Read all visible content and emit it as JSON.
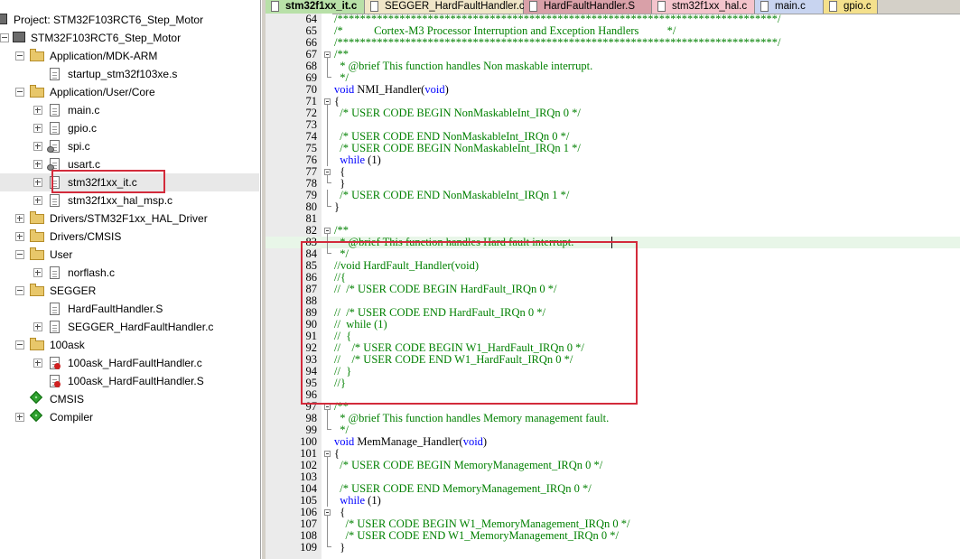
{
  "project": {
    "title": "Project: STM32F103RCT6_Step_Motor",
    "target": "STM32F103RCT6_Step_Motor",
    "groups": [
      {
        "label": "Application/MDK-ARM",
        "files": [
          "startup_stm32f103xe.s"
        ]
      },
      {
        "label": "Application/User/Core",
        "files": [
          "main.c",
          "gpio.c",
          "spi.c",
          "usart.c",
          "stm32f1xx_it.c",
          "stm32f1xx_hal_msp.c"
        ]
      },
      {
        "label": "Drivers/STM32F1xx_HAL_Driver"
      },
      {
        "label": "Drivers/CMSIS"
      },
      {
        "label": "User",
        "files": [
          "norflash.c"
        ]
      },
      {
        "label": "SEGGER",
        "files": [
          "HardFaultHandler.S",
          "SEGGER_HardFaultHandler.c"
        ]
      },
      {
        "label": "100ask",
        "files": [
          "100ask_HardFaultHandler.c",
          "100ask_HardFaultHandler.S"
        ]
      }
    ],
    "components": [
      "CMSIS",
      "Compiler"
    ],
    "selected_file": "stm32f1xx_it.c"
  },
  "tabs": [
    {
      "label": "stm32f1xx_it.c",
      "color": "#b8e0a8",
      "active": true
    },
    {
      "label": "SEGGER_HardFaultHandler.c",
      "color": "#f0e6c8"
    },
    {
      "label": "HardFaultHandler.S",
      "color": "#d9a0a8"
    },
    {
      "label": "stm32f1xx_hal.c",
      "color": "#f4c4cc"
    },
    {
      "label": "main.c",
      "color": "#c8d4f0"
    },
    {
      "label": "gpio.c",
      "color": "#f4e08c"
    }
  ],
  "editor": {
    "current_line": "83",
    "lines": [
      {
        "n": "64",
        "fold": "none",
        "parts": [
          [
            "c",
            "/******************************************************************************/"
          ]
        ]
      },
      {
        "n": "65",
        "fold": "none",
        "parts": [
          [
            "c",
            "/*           Cortex-M3 Processor Interruption and Exception Handlers          */"
          ]
        ]
      },
      {
        "n": "66",
        "fold": "none",
        "parts": [
          [
            "c",
            "/******************************************************************************/"
          ]
        ]
      },
      {
        "n": "67",
        "fold": "start",
        "parts": [
          [
            "c",
            "/**"
          ]
        ]
      },
      {
        "n": "68",
        "fold": "mid",
        "parts": [
          [
            "c",
            "  * @brief This function handles Non maskable interrupt."
          ]
        ]
      },
      {
        "n": "69",
        "fold": "end",
        "parts": [
          [
            "c",
            "  */"
          ]
        ]
      },
      {
        "n": "70",
        "fold": "none",
        "parts": [
          [
            "k",
            "void"
          ],
          [
            "t",
            " NMI_Handler("
          ],
          [
            "k",
            "void"
          ],
          [
            "t",
            ")"
          ]
        ]
      },
      {
        "n": "71",
        "fold": "start",
        "parts": [
          [
            "t",
            "{"
          ]
        ]
      },
      {
        "n": "72",
        "fold": "mid",
        "parts": [
          [
            "c",
            "  /* USER CODE BEGIN NonMaskableInt_IRQn 0 */"
          ]
        ]
      },
      {
        "n": "73",
        "fold": "mid",
        "parts": []
      },
      {
        "n": "74",
        "fold": "mid",
        "parts": [
          [
            "c",
            "  /* USER CODE END NonMaskableInt_IRQn 0 */"
          ]
        ]
      },
      {
        "n": "75",
        "fold": "mid",
        "parts": [
          [
            "c",
            "  /* USER CODE BEGIN NonMaskableInt_IRQn 1 */"
          ]
        ]
      },
      {
        "n": "76",
        "fold": "mid",
        "parts": [
          [
            "t",
            "  "
          ],
          [
            "k",
            "while"
          ],
          [
            "t",
            " (1)"
          ]
        ]
      },
      {
        "n": "77",
        "fold": "start",
        "parts": [
          [
            "t",
            "  {"
          ]
        ]
      },
      {
        "n": "78",
        "fold": "end",
        "parts": [
          [
            "t",
            "  }"
          ]
        ]
      },
      {
        "n": "79",
        "fold": "mid",
        "parts": [
          [
            "c",
            "  /* USER CODE END NonMaskableInt_IRQn 1 */"
          ]
        ]
      },
      {
        "n": "80",
        "fold": "end",
        "parts": [
          [
            "t",
            "}"
          ]
        ]
      },
      {
        "n": "81",
        "fold": "none",
        "parts": []
      },
      {
        "n": "82",
        "fold": "start",
        "parts": [
          [
            "c",
            "/**"
          ]
        ]
      },
      {
        "n": "83",
        "fold": "mid",
        "parts": [
          [
            "c",
            "  * @brief This function handles Hard fault interrupt."
          ]
        ]
      },
      {
        "n": "84",
        "fold": "end",
        "parts": [
          [
            "c",
            "  */"
          ]
        ]
      },
      {
        "n": "85",
        "fold": "none",
        "parts": [
          [
            "c",
            "//void HardFault_Handler(void)"
          ]
        ]
      },
      {
        "n": "86",
        "fold": "none",
        "parts": [
          [
            "c",
            "//{"
          ]
        ]
      },
      {
        "n": "87",
        "fold": "none",
        "parts": [
          [
            "c",
            "//  /* USER CODE BEGIN HardFault_IRQn 0 */"
          ]
        ]
      },
      {
        "n": "88",
        "fold": "none",
        "parts": []
      },
      {
        "n": "89",
        "fold": "none",
        "parts": [
          [
            "c",
            "//  /* USER CODE END HardFault_IRQn 0 */"
          ]
        ]
      },
      {
        "n": "90",
        "fold": "none",
        "parts": [
          [
            "c",
            "//  while (1)"
          ]
        ]
      },
      {
        "n": "91",
        "fold": "none",
        "parts": [
          [
            "c",
            "//  {"
          ]
        ]
      },
      {
        "n": "92",
        "fold": "none",
        "parts": [
          [
            "c",
            "//    /* USER CODE BEGIN W1_HardFault_IRQn 0 */"
          ]
        ]
      },
      {
        "n": "93",
        "fold": "none",
        "parts": [
          [
            "c",
            "//    /* USER CODE END W1_HardFault_IRQn 0 */"
          ]
        ]
      },
      {
        "n": "94",
        "fold": "none",
        "parts": [
          [
            "c",
            "//  }"
          ]
        ]
      },
      {
        "n": "95",
        "fold": "none",
        "parts": [
          [
            "c",
            "//}"
          ]
        ]
      },
      {
        "n": "96",
        "fold": "none",
        "parts": []
      },
      {
        "n": "97",
        "fold": "start",
        "parts": [
          [
            "c",
            "/**"
          ]
        ]
      },
      {
        "n": "98",
        "fold": "mid",
        "parts": [
          [
            "c",
            "  * @brief This function handles Memory management fault."
          ]
        ]
      },
      {
        "n": "99",
        "fold": "end",
        "parts": [
          [
            "c",
            "  */"
          ]
        ]
      },
      {
        "n": "100",
        "fold": "none",
        "parts": [
          [
            "k",
            "void"
          ],
          [
            "t",
            " MemManage_Handler("
          ],
          [
            "k",
            "void"
          ],
          [
            "t",
            ")"
          ]
        ]
      },
      {
        "n": "101",
        "fold": "start",
        "parts": [
          [
            "t",
            "{"
          ]
        ]
      },
      {
        "n": "102",
        "fold": "mid",
        "parts": [
          [
            "c",
            "  /* USER CODE BEGIN MemoryManagement_IRQn 0 */"
          ]
        ]
      },
      {
        "n": "103",
        "fold": "mid",
        "parts": []
      },
      {
        "n": "104",
        "fold": "mid",
        "parts": [
          [
            "c",
            "  /* USER CODE END MemoryManagement_IRQn 0 */"
          ]
        ]
      },
      {
        "n": "105",
        "fold": "mid",
        "parts": [
          [
            "t",
            "  "
          ],
          [
            "k",
            "while"
          ],
          [
            "t",
            " (1)"
          ]
        ]
      },
      {
        "n": "106",
        "fold": "start",
        "parts": [
          [
            "t",
            "  {"
          ]
        ]
      },
      {
        "n": "107",
        "fold": "mid",
        "parts": [
          [
            "c",
            "    /* USER CODE BEGIN W1_MemoryManagement_IRQn 0 */"
          ]
        ]
      },
      {
        "n": "108",
        "fold": "mid",
        "parts": [
          [
            "c",
            "    /* USER CODE END W1_MemoryManagement_IRQn 0 */"
          ]
        ]
      },
      {
        "n": "109",
        "fold": "end",
        "parts": [
          [
            "t",
            "  }"
          ]
        ]
      }
    ]
  },
  "colors": {
    "annotation_red": "#d32b3b",
    "comment_green": "#008000",
    "keyword_blue": "#0000ff",
    "current_line": "#e8f6e8"
  }
}
